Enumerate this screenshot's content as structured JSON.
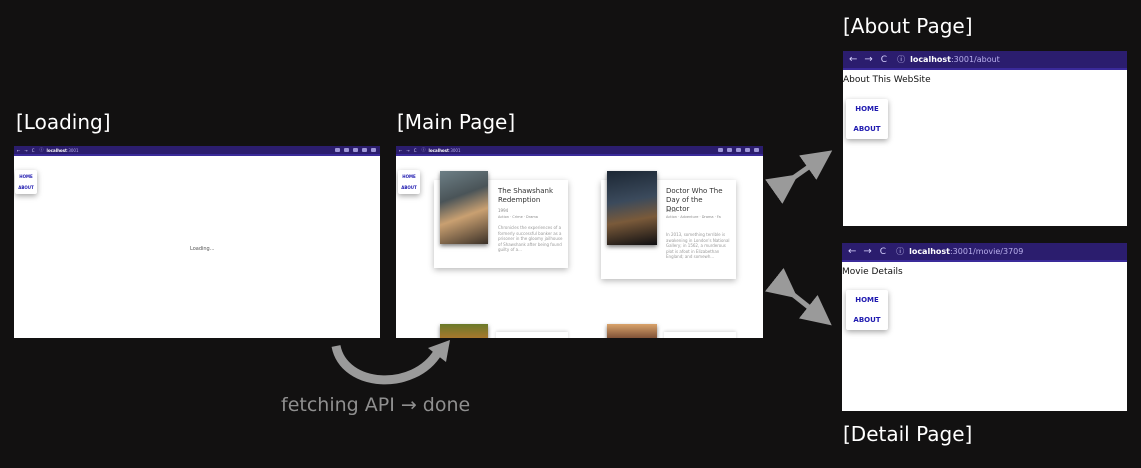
{
  "labels": {
    "loading": "[Loading]",
    "main": "[Main Page]",
    "about": "[About Page]",
    "detail": "[Detail Page]"
  },
  "caption": "fetching API → done",
  "browser": {
    "back_icon": "←",
    "forward_icon": "→",
    "reload_icon": "C",
    "info_icon": "ⓘ",
    "host": "localhost",
    "small_port": ":3001",
    "about_path": ":3001/about",
    "detail_path": ":3001/movie/3709"
  },
  "nav": {
    "home": "HOME",
    "about": "ABOUT"
  },
  "loading_page": {
    "text": "Loading..."
  },
  "about_page": {
    "heading": "About This WebSite"
  },
  "detail_page": {
    "heading": "Movie Details"
  },
  "movies": [
    {
      "title": "The Shawshank Redemption",
      "year": "1994",
      "genres": "Action · Crime · Drama",
      "summary": "Chronicles the experiences of a formerly successful banker as a prisoner in the gloomy jailhouse of Shawshank after being found guilty of a..."
    },
    {
      "title": "Doctor Who The Day of the Doctor",
      "year": "2013",
      "genres": "Action · Adventure · Drama · Fa",
      "summary": "In 2013, something terrible is awakening in London's National Gallery; in 1562, a murderous plot is afoot in Elizabethan England; and somewh..."
    }
  ],
  "colors": {
    "background": "#121111",
    "browser_bar": "#2b1d6e",
    "nav_link": "#1f1ab0",
    "arrow": "#9a9a9a"
  }
}
